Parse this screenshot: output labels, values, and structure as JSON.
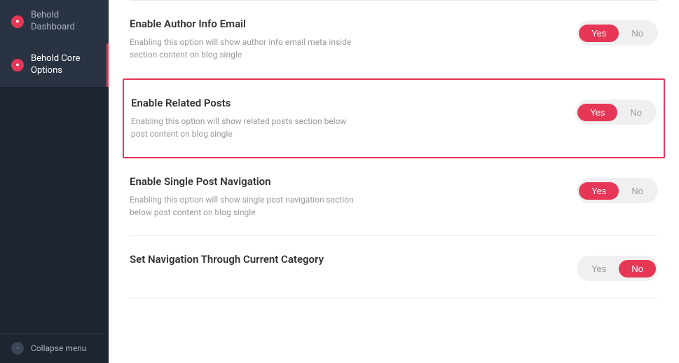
{
  "sidebar": {
    "items": [
      {
        "id": "behold-dashboard",
        "label": "Behold Dashboard",
        "icon_type": "red",
        "icon_symbol": "●",
        "active": false
      },
      {
        "id": "behold-core-options",
        "label": "Behold Core Options",
        "icon_type": "red",
        "icon_symbol": "●",
        "active": true
      }
    ],
    "collapse_label": "Collapse menu",
    "collapse_icon": "−"
  },
  "options": [
    {
      "id": "enable-author-info-email",
      "title": "Enable Author Info Email",
      "description": "Enabling this option will show author info email meta inside section content on blog single",
      "yes_active": true,
      "no_active": false,
      "highlighted": false
    },
    {
      "id": "enable-related-posts",
      "title": "Enable Related Posts",
      "description": "Enabling this option will show related posts section below post content on blog single",
      "yes_active": true,
      "no_active": false,
      "highlighted": true
    },
    {
      "id": "enable-single-post-navigation",
      "title": "Enable Single Post Navigation",
      "description": "Enabling this option will show single post navigation section below post content on blog single",
      "yes_active": true,
      "no_active": false,
      "highlighted": false
    },
    {
      "id": "set-navigation-through-current-category",
      "title": "Set Navigation Through Current Category",
      "description": "",
      "yes_active": false,
      "no_active": true,
      "highlighted": false
    }
  ],
  "toggle_labels": {
    "yes": "Yes",
    "no": "No"
  },
  "colors": {
    "active": "#e63757",
    "sidebar_bg": "#1e2530",
    "sidebar_active_bg": "#2a3341"
  }
}
